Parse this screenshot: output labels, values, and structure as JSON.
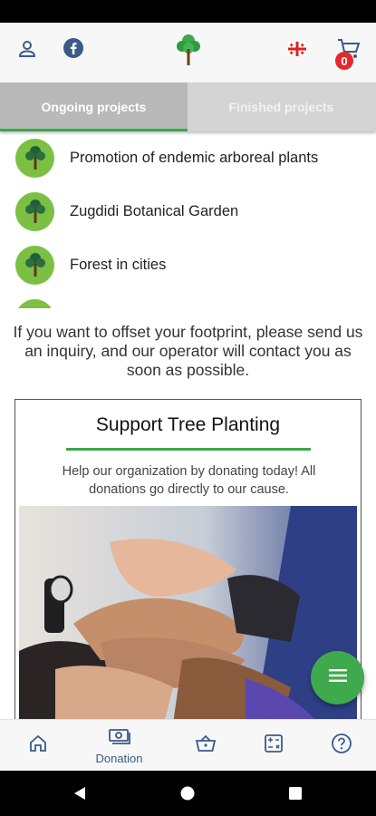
{
  "header": {
    "icons": [
      "user-icon",
      "facebook-icon",
      "tree-logo-icon",
      "georgian-flag-icon",
      "cart-icon"
    ],
    "cart_count": "0",
    "brand_color": "#3aa84a"
  },
  "tabs": [
    {
      "label": "Ongoing projects",
      "active": true
    },
    {
      "label": "Finished projects",
      "active": false
    }
  ],
  "projects": [
    {
      "label": "Promotion of endemic arboreal plants"
    },
    {
      "label": "Zugdidi Botanical Garden"
    },
    {
      "label": "Forest in cities"
    }
  ],
  "notice": "If you want to offset your footprint, please send us an inquiry, and our operator will contact you as soon as possible.",
  "card": {
    "title": "Support Tree Planting",
    "text": "Help our organization by donating today! All donations go directly to our cause."
  },
  "fab": {
    "icon": "menu-icon"
  },
  "bottom_nav": [
    {
      "icon": "home-icon",
      "label": ""
    },
    {
      "icon": "donation-icon",
      "label": "Donation"
    },
    {
      "icon": "basket-icon",
      "label": ""
    },
    {
      "icon": "calculator-icon",
      "label": ""
    },
    {
      "icon": "help-icon",
      "label": ""
    }
  ]
}
